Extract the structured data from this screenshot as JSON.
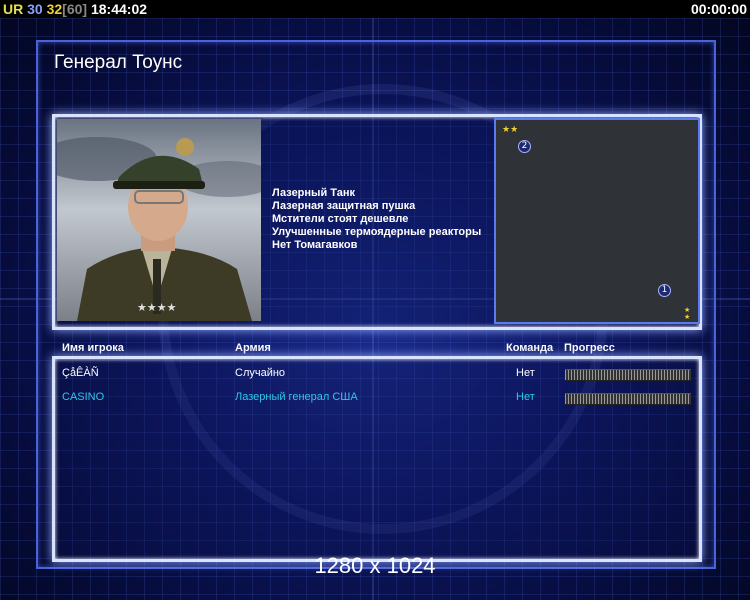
{
  "topbar": {
    "tag": "UR",
    "val1": "30",
    "val2": "32",
    "val3": "[60]",
    "clock": "18:44:02",
    "timer": "00:00:00"
  },
  "title": "Генерал Тоунс",
  "perks": [
    "Лазерный Танк",
    "Лазерная защитная пушка",
    "Мстители стоят дешевле",
    "Улучшенные термоядерные реакторы",
    "Нет Томагавков"
  ],
  "minimap": {
    "markers": [
      "2",
      "1"
    ]
  },
  "table": {
    "headers": {
      "player": "Имя игрока",
      "army": "Армия",
      "team": "Команда",
      "progress": "Прогресс"
    },
    "rows": [
      {
        "name": "ÇåÊÀÑ",
        "army": "Случайно",
        "team": "Нет",
        "color": "#ffffff"
      },
      {
        "name": "CASINO",
        "army": "Лазерный генерал США",
        "team": "Нет",
        "color": "#2fc8e8"
      }
    ]
  },
  "resolution": "1280 x 1024",
  "colors": {
    "panel_border": "#d8e4ff",
    "background": "#0d1660",
    "accent_cyan": "#2fc8e8",
    "minimap_bg": "#2f3236"
  }
}
